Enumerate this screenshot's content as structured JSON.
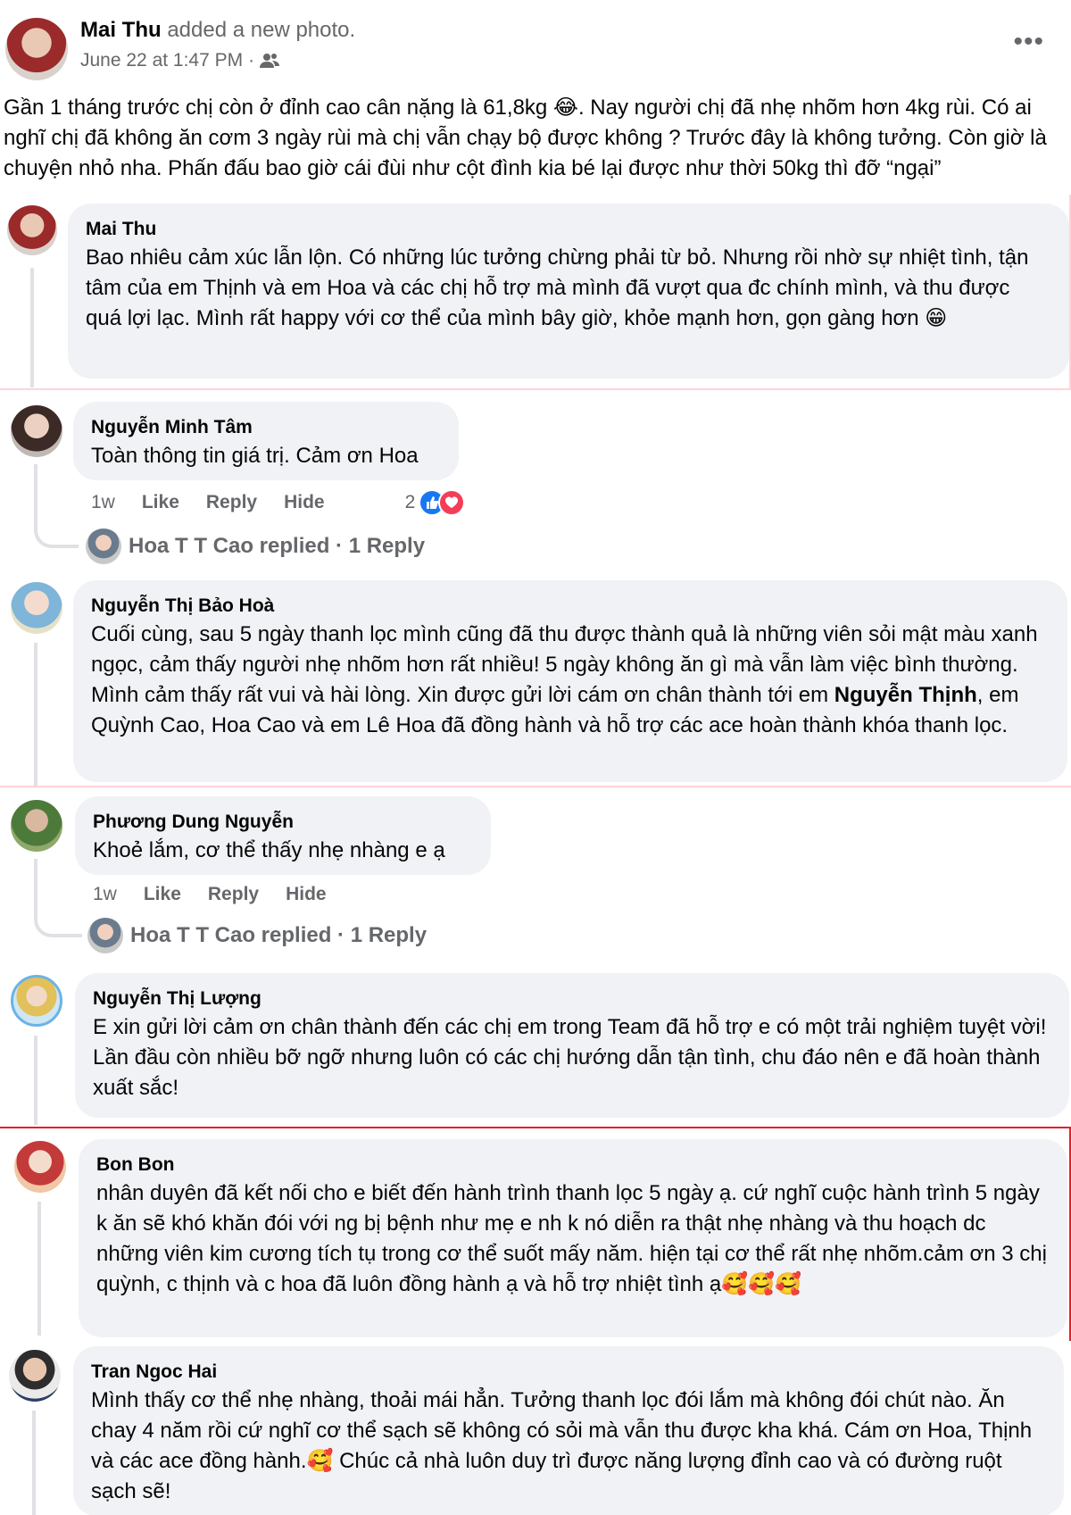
{
  "post": {
    "author": "Mai Thu",
    "action": " added a new photo.",
    "timestamp": "June 22 at 1:47 PM",
    "separator": "·",
    "text": "Gần 1 tháng trước chị còn ở đỉnh cao cân nặng là 61,8kg 😂. Nay người chị đã nhẹ nhõm hơn 4kg rùi. Có ai nghĩ chị đã không ăn cơm 3 ngày rùi mà chị vẫn chạy bộ được không ? Trước đây là không tưởng. Còn giờ là chuyện nhỏ nha. Phấn đấu bao giờ cái đùi như cột đình kia bé lại được như thời 50kg thì đỡ “ngại”",
    "audience_icon": "friends-icon",
    "more_icon": "more-options-icon"
  },
  "comments": [
    {
      "name": "Mai Thu",
      "text": "Bao nhiêu cảm xúc lẫn lộn. Có những lúc tưởng chừng phải từ bỏ. Nhưng rồi nhờ sự nhiệt tình, tận tâm của em Thịnh và em Hoa và các chị hỗ trợ mà mình đã vượt qua đc chính mình, và thu được quá lợi lạc. Mình rất happy với cơ thể của mình bây giờ, khỏe mạnh hơn, gọn gàng hơn 😁"
    },
    {
      "name": "Nguyễn Minh Tâm",
      "text": "Toàn thông tin giá trị. Cảm ơn Hoa",
      "time": "1w",
      "like": "Like",
      "reply": "Reply",
      "hide": "Hide",
      "reaction_count": "2",
      "replied": "Hoa T T Cao replied · 1 Reply"
    },
    {
      "name": "Nguyễn Thị Bảo Hoà",
      "text_a": "Cuối cùng, sau 5 ngày thanh lọc mình cũng đã thu được thành quả là những viên sỏi mật màu xanh ngọc, cảm thấy người nhẹ nhõm hơn rất nhiều! 5 ngày không ăn gì mà vẫn làm việc bình thường. Mình cảm thấy rất vui và hài lòng. Xin được gửi lời cám ơn chân thành tới em ",
      "text_bold": "Nguyễn Thịnh",
      "text_b": ", em Quỳnh Cao, Hoa Cao và em Lê Hoa đã đồng hành và hỗ trợ các ace hoàn thành khóa thanh lọc."
    },
    {
      "name": "Phương Dung Nguyễn",
      "text": "Khoẻ lắm, cơ thể thấy nhẹ nhàng e ạ",
      "time": "1w",
      "like": "Like",
      "reply": "Reply",
      "hide": "Hide",
      "replied": "Hoa T T Cao replied · 1 Reply"
    },
    {
      "name": "Nguyễn Thị Lượng",
      "text": "E xin gửi lời cảm ơn chân thành đến các chị em trong Team đã hỗ trợ e có một trải nghiệm tuyệt vời! Lần đầu còn nhiều bỡ ngỡ nhưng luôn có các chị hướng dẫn tận tình, chu đáo nên e đã hoàn thành xuất sắc!"
    },
    {
      "name": "Bon Bon",
      "text": "nhân duyên đã kết nối cho e biết đến hành trình thanh lọc 5 ngày ạ. cứ nghĩ cuộc hành trình 5 ngày k ăn sẽ khó khăn đói với ng bị bệnh như mẹ e nh k nó diễn ra thật nhẹ nhàng và thu hoạch dc những viên kim cương tích tụ trong cơ thể suốt mấy năm. hiện tại cơ thể rất nhẹ nhõm.cảm ơn 3 chị quỳnh, c thịnh và c hoa đã luôn đồng hành ạ và hỗ trợ nhiệt tình ạ🥰🥰🥰"
    },
    {
      "name": "Tran Ngoc Hai",
      "text": "Mình thấy cơ thể nhẹ nhàng, thoải mái hẳn. Tưởng thanh lọc đói lắm mà không đói chút nào. Ăn chay 4 năm rồi cứ nghĩ cơ thể sạch sẽ không có sỏi mà vẫn thu được kha khá. Cám ơn Hoa, Thịnh và các ace đồng hành.🥰 Chúc cả nhà luôn duy trì được năng lượng đỉnh cao và có đường ruột sạch sẽ!"
    }
  ],
  "colors": {
    "bubble": "#f0f2f5",
    "secondary_text": "#65676b",
    "like_blue": "#1877f2",
    "love_red": "#f33e58",
    "divider_red": "#e4202a"
  }
}
